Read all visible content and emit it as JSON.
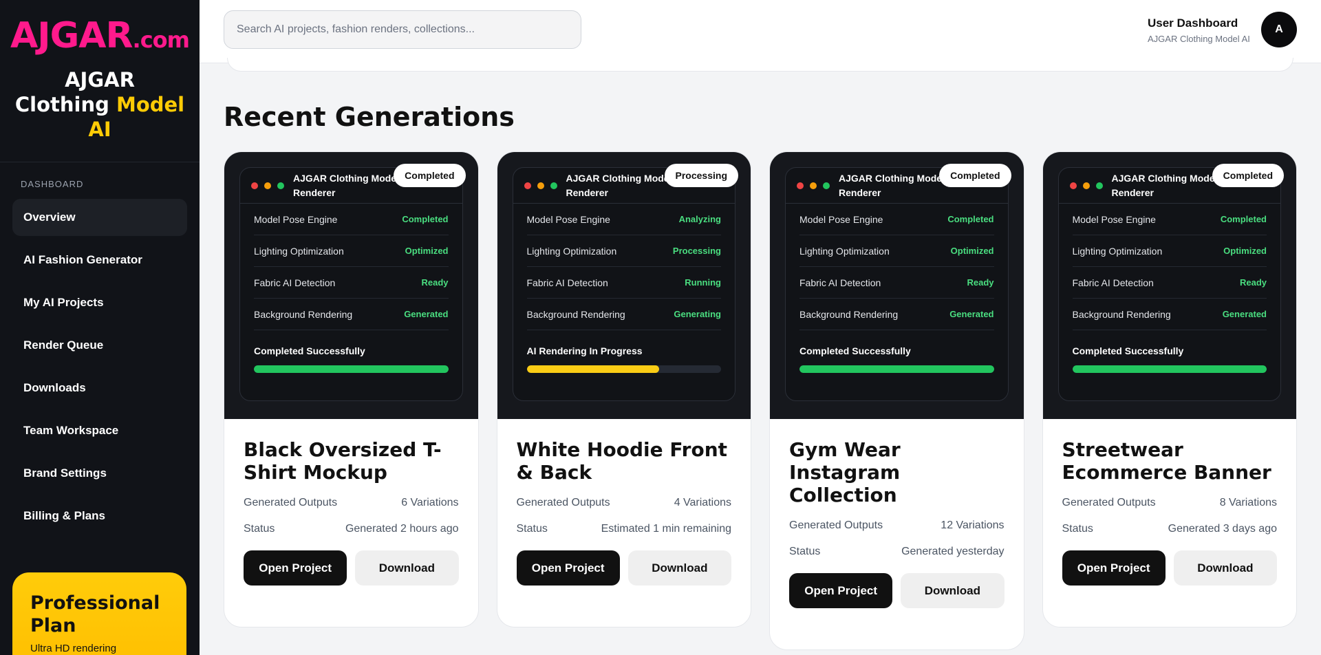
{
  "brand": {
    "logo_main": "AJGAR",
    "logo_tld": ".com",
    "title_line1": "AJGAR",
    "title_line2_a": "Clothing",
    "title_line2_b": "Model",
    "title_line3": "AI"
  },
  "sidebar": {
    "heading": "DASHBOARD",
    "items": [
      {
        "label": "Overview",
        "active": true
      },
      {
        "label": "AI Fashion Generator"
      },
      {
        "label": "My AI Projects"
      },
      {
        "label": "Render Queue"
      },
      {
        "label": "Downloads"
      },
      {
        "label": "Team Workspace"
      },
      {
        "label": "Brand Settings"
      },
      {
        "label": "Billing & Plans"
      }
    ],
    "plan": {
      "title": "Professional Plan",
      "subtitle": "Ultra HD rendering"
    }
  },
  "header": {
    "search_placeholder": "Search AI projects, fashion renders, collections...",
    "user_title": "User Dashboard",
    "user_subtitle": "AJGAR Clothing Model AI",
    "avatar_initial": "A"
  },
  "main": {
    "section_title": "Recent Generations",
    "cards": [
      {
        "preview_title": "AJGAR Clothing Model Renderer",
        "status": "Completed",
        "metrics": [
          {
            "label": "Model Pose Engine",
            "value": "Completed"
          },
          {
            "label": "Lighting Optimization",
            "value": "Optimized"
          },
          {
            "label": "Fabric AI Detection",
            "value": "Ready"
          },
          {
            "label": "Background Rendering",
            "value": "Generated"
          }
        ],
        "progress_label": "Completed Successfully",
        "progress": 1.0,
        "progress_color": "#22c55e",
        "title": "Black Oversized T-Shirt Mockup",
        "outputs_label": "Generated Outputs",
        "outputs_value": "6 Variations",
        "status_label": "Status",
        "status_value": "Generated 2 hours ago",
        "open_label": "Open Project",
        "download_label": "Download"
      },
      {
        "preview_title": "AJGAR Clothing Model Renderer",
        "status": "Processing",
        "metrics": [
          {
            "label": "Model Pose Engine",
            "value": "Analyzing"
          },
          {
            "label": "Lighting Optimization",
            "value": "Processing"
          },
          {
            "label": "Fabric AI Detection",
            "value": "Running"
          },
          {
            "label": "Background Rendering",
            "value": "Generating"
          }
        ],
        "progress_label": "AI Rendering In Progress",
        "progress": 0.68,
        "progress_color": "#facc15",
        "title": "White Hoodie Front & Back",
        "outputs_label": "Generated Outputs",
        "outputs_value": "4 Variations",
        "status_label": "Status",
        "status_value": "Estimated 1 min remaining",
        "open_label": "Open Project",
        "download_label": "Download"
      },
      {
        "preview_title": "AJGAR Clothing Model Renderer",
        "status": "Completed",
        "metrics": [
          {
            "label": "Model Pose Engine",
            "value": "Completed"
          },
          {
            "label": "Lighting Optimization",
            "value": "Optimized"
          },
          {
            "label": "Fabric AI Detection",
            "value": "Ready"
          },
          {
            "label": "Background Rendering",
            "value": "Generated"
          }
        ],
        "progress_label": "Completed Successfully",
        "progress": 1.0,
        "progress_color": "#22c55e",
        "title": "Gym Wear Instagram Collection",
        "outputs_label": "Generated Outputs",
        "outputs_value": "12 Variations",
        "status_label": "Status",
        "status_value": "Generated yesterday",
        "open_label": "Open Project",
        "download_label": "Download"
      },
      {
        "preview_title": "AJGAR Clothing Model Renderer",
        "status": "Completed",
        "metrics": [
          {
            "label": "Model Pose Engine",
            "value": "Completed"
          },
          {
            "label": "Lighting Optimization",
            "value": "Optimized"
          },
          {
            "label": "Fabric AI Detection",
            "value": "Ready"
          },
          {
            "label": "Background Rendering",
            "value": "Generated"
          }
        ],
        "progress_label": "Completed Successfully",
        "progress": 1.0,
        "progress_color": "#22c55e",
        "title": "Streetwear Ecommerce Banner",
        "outputs_label": "Generated Outputs",
        "outputs_value": "8 Variations",
        "status_label": "Status",
        "status_value": "Generated 3 days ago",
        "open_label": "Open Project",
        "download_label": "Download"
      }
    ]
  },
  "colors": {
    "brand_pink": "#ff1a8c",
    "brand_yellow": "#ffcb05",
    "sidebar_bg": "#111318",
    "status_green": "#4ade80"
  }
}
